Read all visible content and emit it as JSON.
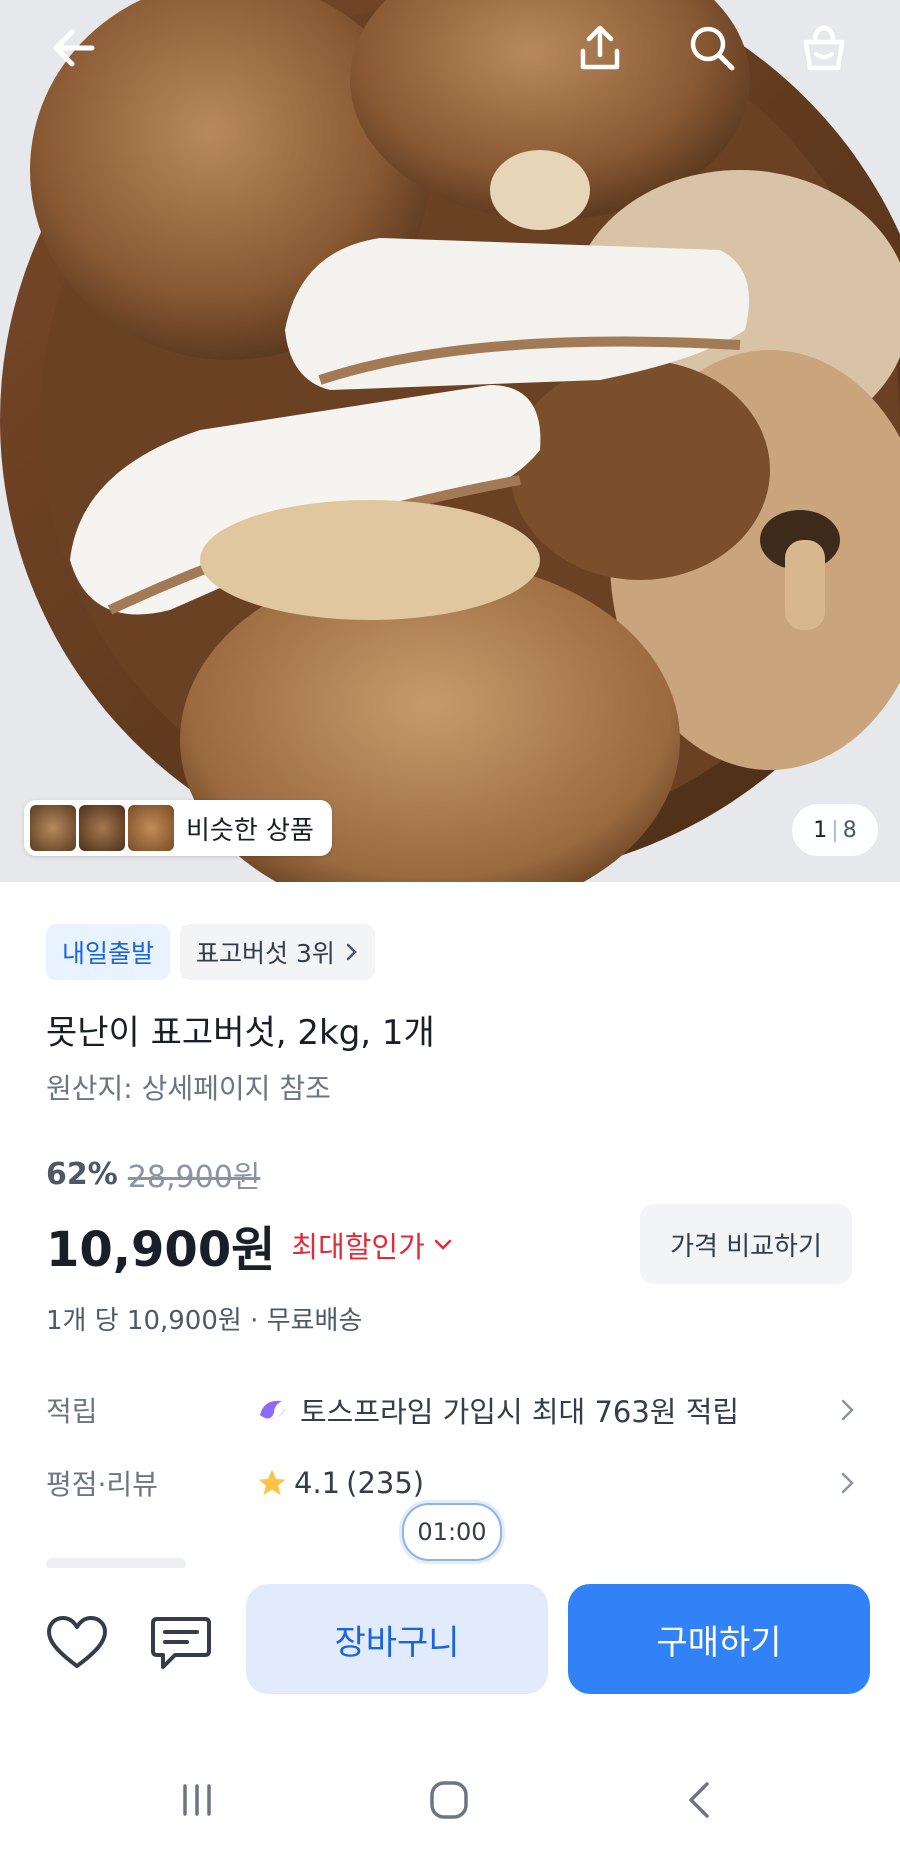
{
  "product_image": {
    "description_icon": "mushroom-photo"
  },
  "topbar": {
    "back_icon": "arrow-left-icon",
    "share_icon": "share-icon",
    "search_icon": "search-icon",
    "cart_icon": "shopping-bag-icon"
  },
  "similar": {
    "label": "비슷한 상품"
  },
  "pager": {
    "current": "1",
    "total": "8"
  },
  "badges": {
    "delivery": "내일출발",
    "rank": "표고버섯 3위"
  },
  "product": {
    "title": "못난이 표고버섯, 2kg, 1개",
    "origin": "원산지: 상세페이지 참조",
    "discount_pct": "62%",
    "original_price": "28,900원",
    "price": "10,900원",
    "max_discount_label": "최대할인가",
    "compare_label": "가격 비교하기",
    "unit_info": "1개 당 10,900원 · 무료배송"
  },
  "info": {
    "points_key": "적립",
    "points_value": "토스프라임 가입시 최대 763원 적립",
    "review_key": "평점·리뷰",
    "rating": "4.1",
    "review_count": "(235)"
  },
  "timer": "01:00",
  "actions": {
    "cart_label": "장바구니",
    "buy_label": "구매하기"
  },
  "colors": {
    "accent": "#3182f6",
    "discount_red": "#e42939",
    "badge_blue": "#1b64da"
  }
}
